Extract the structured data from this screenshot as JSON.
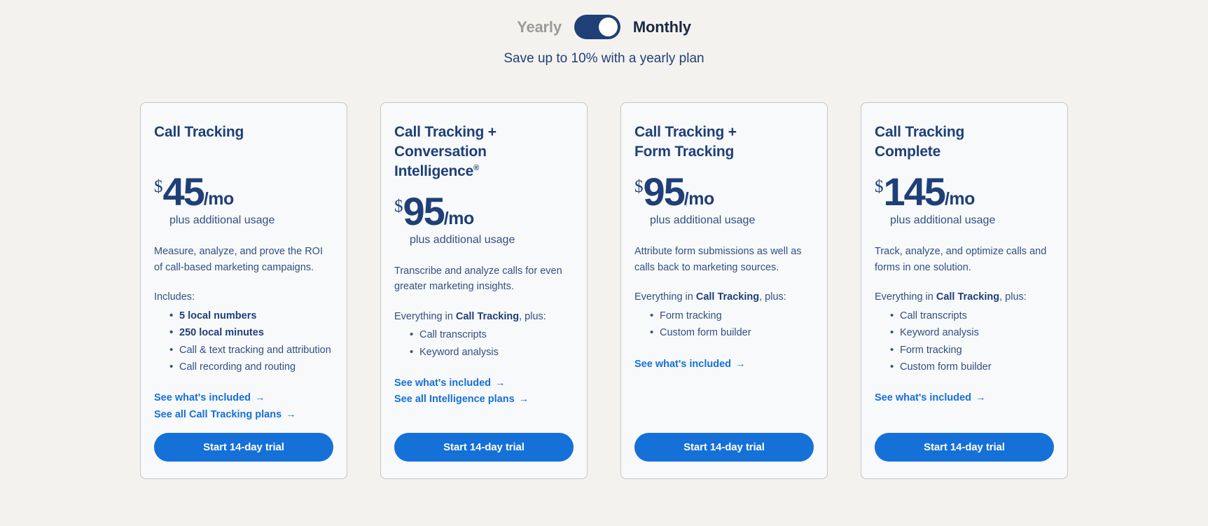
{
  "billing_toggle": {
    "yearly_label": "Yearly",
    "monthly_label": "Monthly",
    "selected": "Monthly",
    "savings_note": "Save up to 10% with a yearly plan",
    "track_color": "#1f3f77",
    "knob_color": "#ffffff"
  },
  "theme": {
    "page_background": "#f4f2ef",
    "card_background": "#f8f9fb",
    "card_border": "#c9c6c2",
    "navy": "#1f3f77",
    "body_text": "#31507f",
    "accent_blue": "#1570d8"
  },
  "plans": [
    {
      "title_line1": "Call Tracking",
      "title_line2": "",
      "registered": false,
      "currency": "$",
      "amount": "45",
      "period": "/mo",
      "price_note": "plus additional usage",
      "description": "Measure, analyze, and prove the ROI of call-based marketing campaigns.",
      "includes_prefix": "Includes:",
      "includes_bold": "",
      "includes_suffix": "",
      "features": [
        {
          "text": "5 local numbers",
          "bold": true
        },
        {
          "text": "250 local minutes",
          "bold": true
        },
        {
          "text": "Call & text tracking and attribution",
          "bold": false
        },
        {
          "text": "Call recording and routing",
          "bold": false
        }
      ],
      "links": [
        "See what's included",
        "See all Call Tracking plans"
      ],
      "cta_label": "Start 14-day trial"
    },
    {
      "title_line1": "Call Tracking +",
      "title_line2": "Conversation Intelligence",
      "registered": true,
      "currency": "$",
      "amount": "95",
      "period": "/mo",
      "price_note": "plus additional usage",
      "description": "Transcribe and analyze calls for even greater marketing insights.",
      "includes_prefix": "Everything in ",
      "includes_bold": "Call Tracking",
      "includes_suffix": ", plus:",
      "features": [
        {
          "text": "Call transcripts",
          "bold": false
        },
        {
          "text": "Keyword analysis",
          "bold": false
        }
      ],
      "links": [
        "See what's included",
        "See all Intelligence plans"
      ],
      "cta_label": "Start 14-day trial"
    },
    {
      "title_line1": "Call Tracking +",
      "title_line2": "Form Tracking",
      "registered": false,
      "currency": "$",
      "amount": "95",
      "period": "/mo",
      "price_note": "plus additional usage",
      "description": "Attribute form submissions as well as calls back to marketing sources.",
      "includes_prefix": "Everything in ",
      "includes_bold": "Call Tracking",
      "includes_suffix": ", plus:",
      "features": [
        {
          "text": "Form tracking",
          "bold": false
        },
        {
          "text": "Custom form builder",
          "bold": false
        }
      ],
      "links": [
        "See what's included"
      ],
      "cta_label": "Start 14-day trial"
    },
    {
      "title_line1": "Call Tracking",
      "title_line2": "Complete",
      "registered": false,
      "currency": "$",
      "amount": "145",
      "period": "/mo",
      "price_note": "plus additional usage",
      "description": "Track, analyze, and optimize calls and forms in one solution.",
      "includes_prefix": "Everything in ",
      "includes_bold": "Call Tracking",
      "includes_suffix": ", plus:",
      "features": [
        {
          "text": "Call transcripts",
          "bold": false
        },
        {
          "text": "Keyword analysis",
          "bold": false
        },
        {
          "text": "Form tracking",
          "bold": false
        },
        {
          "text": "Custom form builder",
          "bold": false
        }
      ],
      "links": [
        "See what's included"
      ],
      "cta_label": "Start 14-day trial"
    }
  ],
  "icons": {
    "arrow_right": "→",
    "registered_mark": "®"
  }
}
